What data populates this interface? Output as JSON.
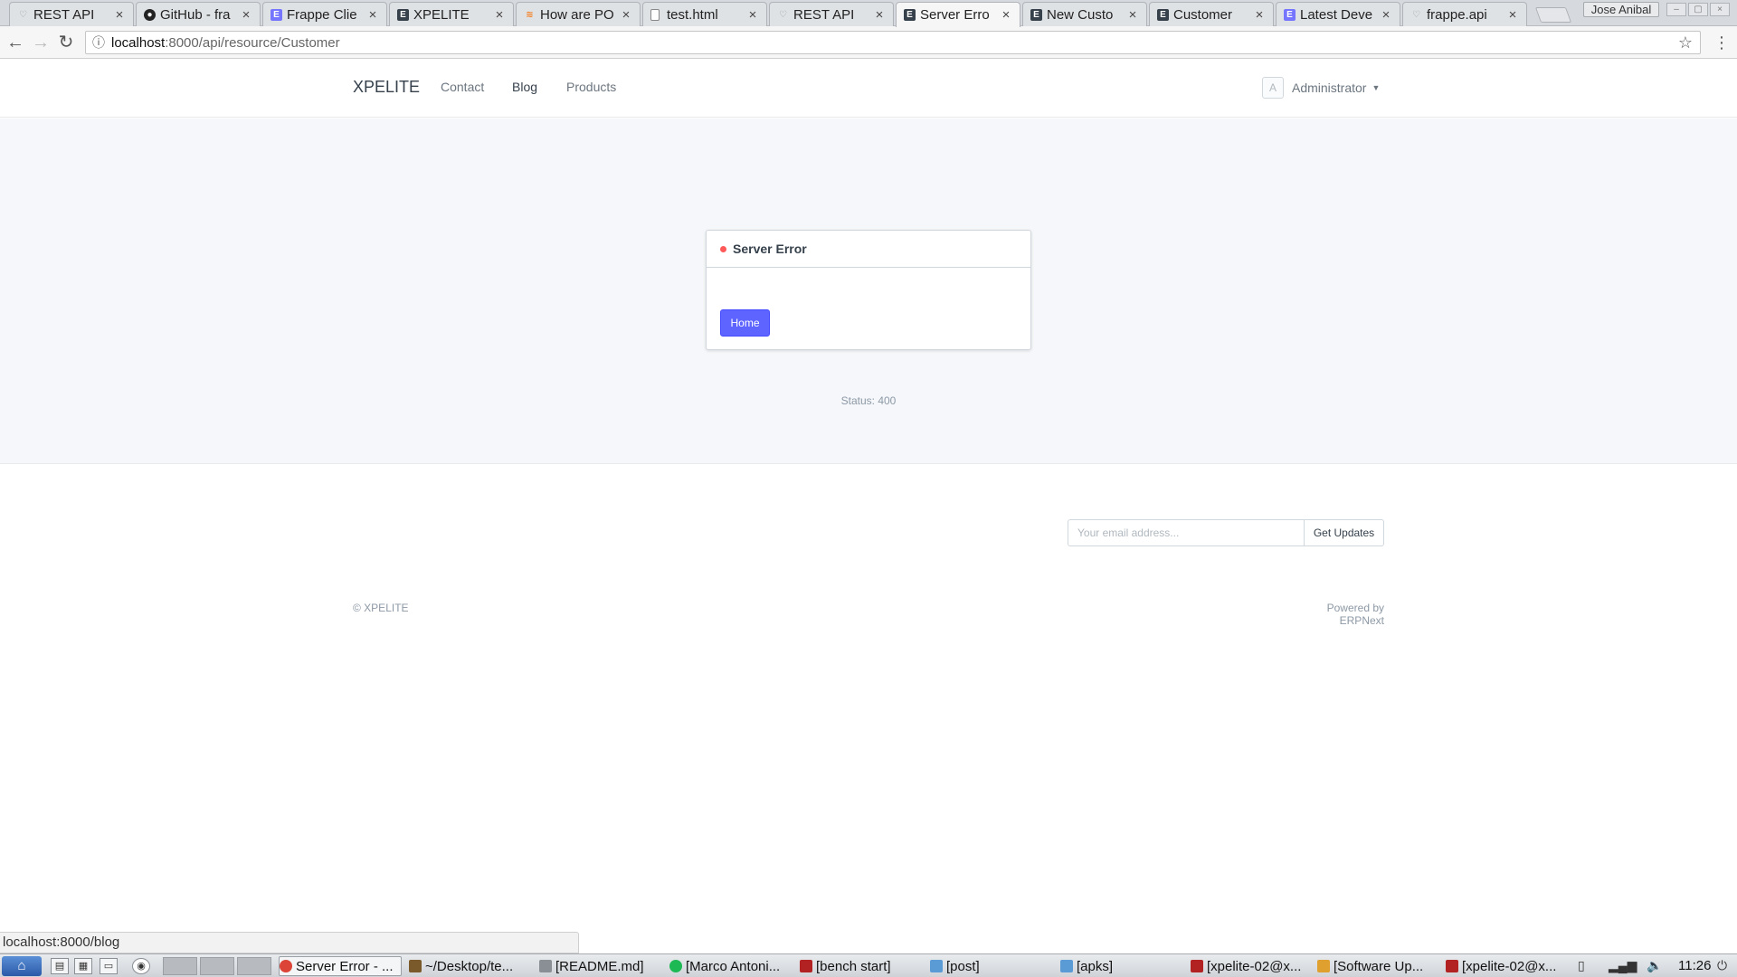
{
  "browser": {
    "tabs": [
      {
        "label": "REST API",
        "icon": "heart-icon",
        "color": "#9aa0a6"
      },
      {
        "label": "GitHub - fra",
        "icon": "github-icon",
        "color": "#222222"
      },
      {
        "label": "Frappe Clie",
        "icon": "e-icon",
        "color": "#7575ff"
      },
      {
        "label": "XPELITE",
        "icon": "e-icon",
        "color": "#36414c"
      },
      {
        "label": "How are PO",
        "icon": "stackoverflow-icon",
        "color": "#f48024"
      },
      {
        "label": "test.html",
        "icon": "file-icon",
        "color": "#9aa0a6"
      },
      {
        "label": "REST API",
        "icon": "heart-icon",
        "color": "#9aa0a6"
      },
      {
        "label": "Server Erro",
        "icon": "e-icon",
        "color": "#36414c"
      },
      {
        "label": "New Custo",
        "icon": "e-icon",
        "color": "#36414c"
      },
      {
        "label": "Customer",
        "icon": "e-icon",
        "color": "#36414c"
      },
      {
        "label": "Latest Deve",
        "icon": "e-icon",
        "color": "#7575ff"
      },
      {
        "label": "frappe.api",
        "icon": "heart-icon",
        "color": "#9aa0a6"
      }
    ],
    "active_tab_index": 7,
    "profile_name": "Jose Anibal",
    "url_host": "localhost",
    "url_path": ":8000/api/resource/Customer"
  },
  "navbar": {
    "brand": "XPELITE",
    "links": [
      "Contact",
      "Blog",
      "Products"
    ],
    "user_initial": "A",
    "user_name": "Administrator"
  },
  "error_card": {
    "title": "Server Error",
    "home_button": "Home",
    "status_text": "Status: 400"
  },
  "footer": {
    "email_placeholder": "Your email address...",
    "subscribe_button": "Get Updates",
    "copyright": "© XPELITE",
    "powered_prefix": "Powered by ",
    "powered_link": "ERPNext"
  },
  "status_bubble": "localhost:8000/blog",
  "taskbar": {
    "tasks": [
      {
        "label": "Server Error - ...",
        "color": "#db4437"
      },
      {
        "label": "~/Desktop/te...",
        "color": "#7a5a2a"
      },
      {
        "label": "[README.md]",
        "color": "#8a8f95"
      },
      {
        "label": "[Marco Antoni...",
        "color": "#1db954"
      },
      {
        "label": "[bench start]",
        "color": "#b22222"
      },
      {
        "label": "[post]",
        "color": "#5b9bd5"
      },
      {
        "label": "[apks]",
        "color": "#5b9bd5"
      },
      {
        "label": "[xpelite-02@x...",
        "color": "#b22222"
      },
      {
        "label": "[Software Up...",
        "color": "#e0a030"
      },
      {
        "label": "[xpelite-02@x...",
        "color": "#b22222"
      }
    ],
    "clock": "11:26"
  },
  "colors": {
    "primary": "#5e64ff",
    "error_dot": "#ff5858",
    "muted_text": "#8d99a6"
  }
}
